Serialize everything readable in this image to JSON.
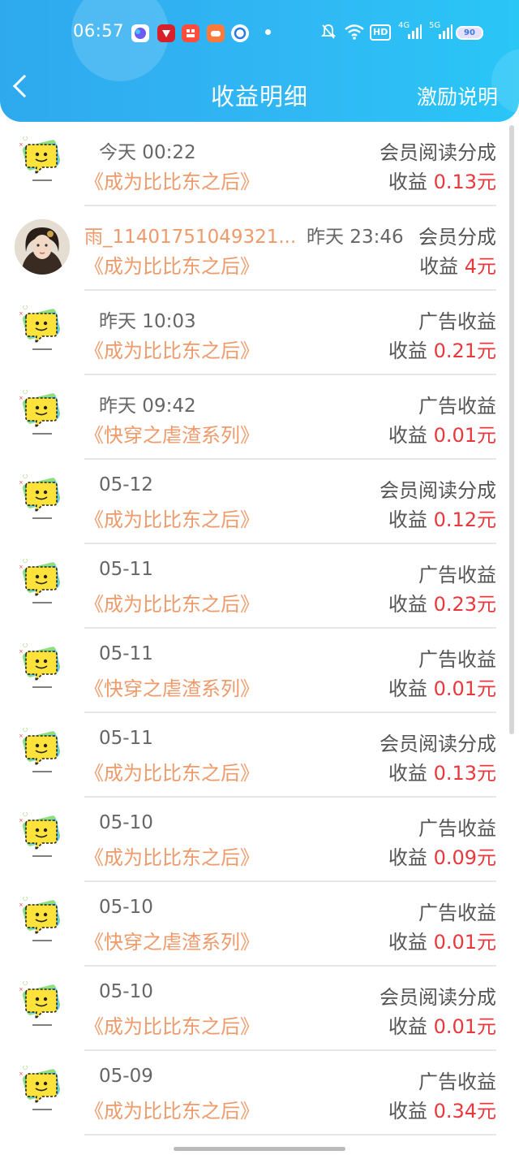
{
  "status_bar": {
    "time": "06:57",
    "battery": "90",
    "network_4g": "4G",
    "network_5g": "5G",
    "hd": "HD"
  },
  "header": {
    "title": "收益明细",
    "right_link": "激励说明"
  },
  "colors": {
    "header_gradient": [
      "#2ea9ee",
      "#29c6f6"
    ],
    "book_title": "#ee9a6b",
    "amount_value": "#e8383d",
    "text_gray": "#666666"
  },
  "rows": [
    {
      "kind": "icon",
      "time": "今天 00:22",
      "book": "《成为比比东之后》",
      "type": "会员阅读分成",
      "amount_label": "收益",
      "amount": "0.13元"
    },
    {
      "kind": "user",
      "user": "雨_11401751049321...",
      "time": "昨天 23:46",
      "book": "《成为比比东之后》",
      "type": "会员分成",
      "amount_label": "收益",
      "amount": "4元"
    },
    {
      "kind": "icon",
      "time": "昨天 10:03",
      "book": "《成为比比东之后》",
      "type": "广告收益",
      "amount_label": "收益",
      "amount": "0.21元"
    },
    {
      "kind": "icon",
      "time": "昨天 09:42",
      "book": "《快穿之虐渣系列》",
      "type": "广告收益",
      "amount_label": "收益",
      "amount": "0.01元"
    },
    {
      "kind": "icon",
      "time": "05-12",
      "book": "《成为比比东之后》",
      "type": "会员阅读分成",
      "amount_label": "收益",
      "amount": "0.12元"
    },
    {
      "kind": "icon",
      "time": "05-11",
      "book": "《成为比比东之后》",
      "type": "广告收益",
      "amount_label": "收益",
      "amount": "0.23元"
    },
    {
      "kind": "icon",
      "time": "05-11",
      "book": "《快穿之虐渣系列》",
      "type": "广告收益",
      "amount_label": "收益",
      "amount": "0.01元"
    },
    {
      "kind": "icon",
      "time": "05-11",
      "book": "《成为比比东之后》",
      "type": "会员阅读分成",
      "amount_label": "收益",
      "amount": "0.13元"
    },
    {
      "kind": "icon",
      "time": "05-10",
      "book": "《成为比比东之后》",
      "type": "广告收益",
      "amount_label": "收益",
      "amount": "0.09元"
    },
    {
      "kind": "icon",
      "time": "05-10",
      "book": "《快穿之虐渣系列》",
      "type": "广告收益",
      "amount_label": "收益",
      "amount": "0.01元"
    },
    {
      "kind": "icon",
      "time": "05-10",
      "book": "《成为比比东之后》",
      "type": "会员阅读分成",
      "amount_label": "收益",
      "amount": "0.01元"
    },
    {
      "kind": "icon",
      "time": "05-09",
      "book": "《成为比比东之后》",
      "type": "广告收益",
      "amount_label": "收益",
      "amount": "0.34元"
    }
  ]
}
